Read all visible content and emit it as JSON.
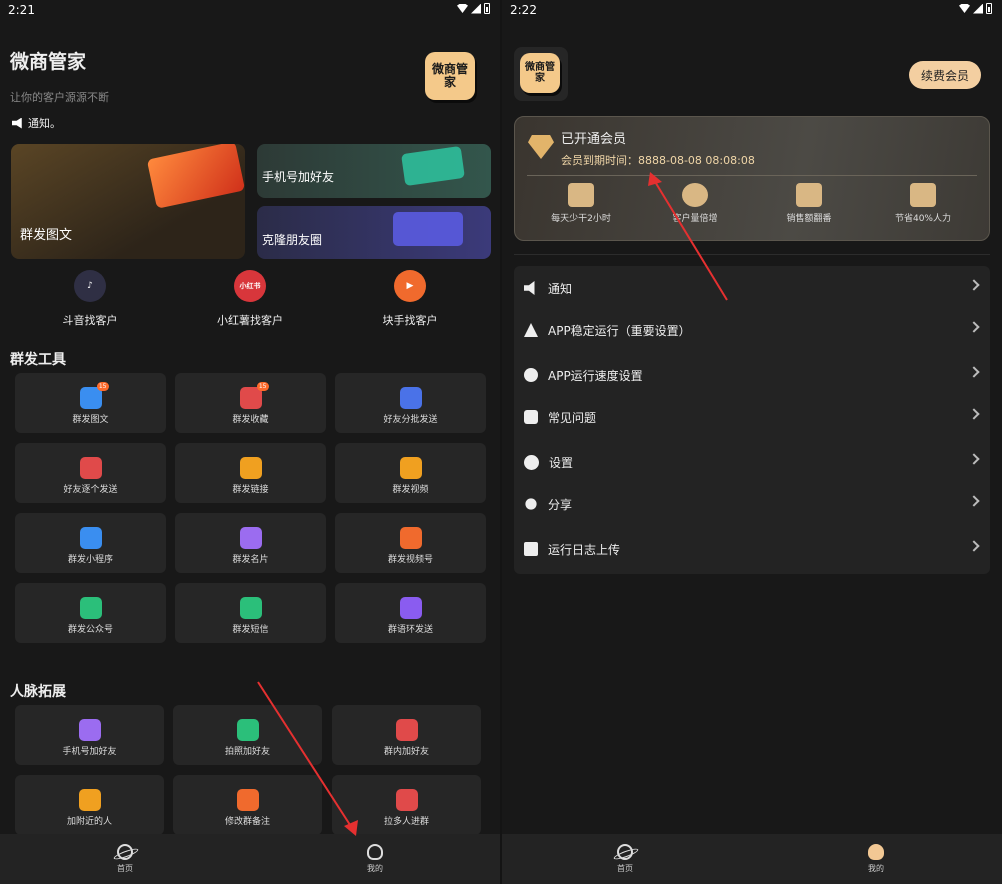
{
  "left": {
    "status_time": "2:21",
    "app_title": "微商管家",
    "app_subtitle": "让你的客户源源不断",
    "notice": "通知。",
    "logo_text": "微商管家",
    "banners": {
      "big": "群发图文",
      "top_right": "手机号加好友",
      "bottom_right": "克隆朋友圈"
    },
    "quick": [
      {
        "label": "斗音找客户",
        "icon": "tiktok-icon",
        "color": "#2f2f44",
        "glyph": "♪"
      },
      {
        "label": "小红薯找客户",
        "icon": "xiaohongshu-icon",
        "color": "#d8363b",
        "glyph": "小红书"
      },
      {
        "label": "块手找客户",
        "icon": "kuaishou-icon",
        "color": "#f06a2d",
        "glyph": "▶"
      }
    ],
    "section_tools": "群发工具",
    "tools": [
      {
        "label": "群发图文",
        "color": "#3a8ef0",
        "badge": "15"
      },
      {
        "label": "群发收藏",
        "color": "#e04a4a",
        "badge": "15"
      },
      {
        "label": "好友分批发送",
        "color": "#4a72e8",
        "badge": ""
      },
      {
        "label": "好友逐个发送",
        "color": "#e04a4a",
        "badge": ""
      },
      {
        "label": "群发链接",
        "color": "#f0a020",
        "badge": ""
      },
      {
        "label": "群发视频",
        "color": "#f0a020",
        "badge": ""
      },
      {
        "label": "群发小程序",
        "color": "#3a8ef0",
        "badge": ""
      },
      {
        "label": "群发名片",
        "color": "#9b6cf0",
        "badge": ""
      },
      {
        "label": "群发视频号",
        "color": "#f06a2d",
        "badge": ""
      },
      {
        "label": "群发公众号",
        "color": "#2bbf7a",
        "badge": ""
      },
      {
        "label": "群发短信",
        "color": "#2bbf7a",
        "badge": ""
      },
      {
        "label": "群语环发送",
        "color": "#8a5cf0",
        "badge": ""
      }
    ],
    "section_network": "人脉拓展",
    "network": [
      {
        "label": "手机号加好友",
        "color": "#9b6cf0"
      },
      {
        "label": "拍照加好友",
        "color": "#2bbf7a"
      },
      {
        "label": "群内加好友",
        "color": "#e04a4a"
      },
      {
        "label": "加附近的人",
        "color": "#f0a020"
      },
      {
        "label": "修改群备注",
        "color": "#f06a2d"
      },
      {
        "label": "拉多人进群",
        "color": "#e04a4a"
      }
    ],
    "nav": {
      "home": "首页",
      "mine": "我的"
    }
  },
  "right": {
    "status_time": "2:22",
    "logo_text": "微商管家",
    "renew_label": "续费会员",
    "vip": {
      "title": "已开通会员",
      "expire": "会员到期时间：8888-08-08 08:08:08",
      "perks": [
        "每天少干2小时",
        "客户量倍增",
        "销售额翻番",
        "节省40%人力"
      ]
    },
    "menu": [
      {
        "label": "通知",
        "icon": "speaker-icon"
      },
      {
        "label": "APP稳定运行（重要设置）",
        "icon": "warning-icon"
      },
      {
        "label": "APP运行速度设置",
        "icon": "speedometer-icon"
      },
      {
        "label": "常见问题",
        "icon": "question-icon"
      },
      {
        "label": "设置",
        "icon": "gear-icon"
      },
      {
        "label": "分享",
        "icon": "share-icon"
      },
      {
        "label": "运行日志上传",
        "icon": "upload-icon"
      }
    ],
    "nav": {
      "home": "首页",
      "mine": "我的"
    }
  }
}
